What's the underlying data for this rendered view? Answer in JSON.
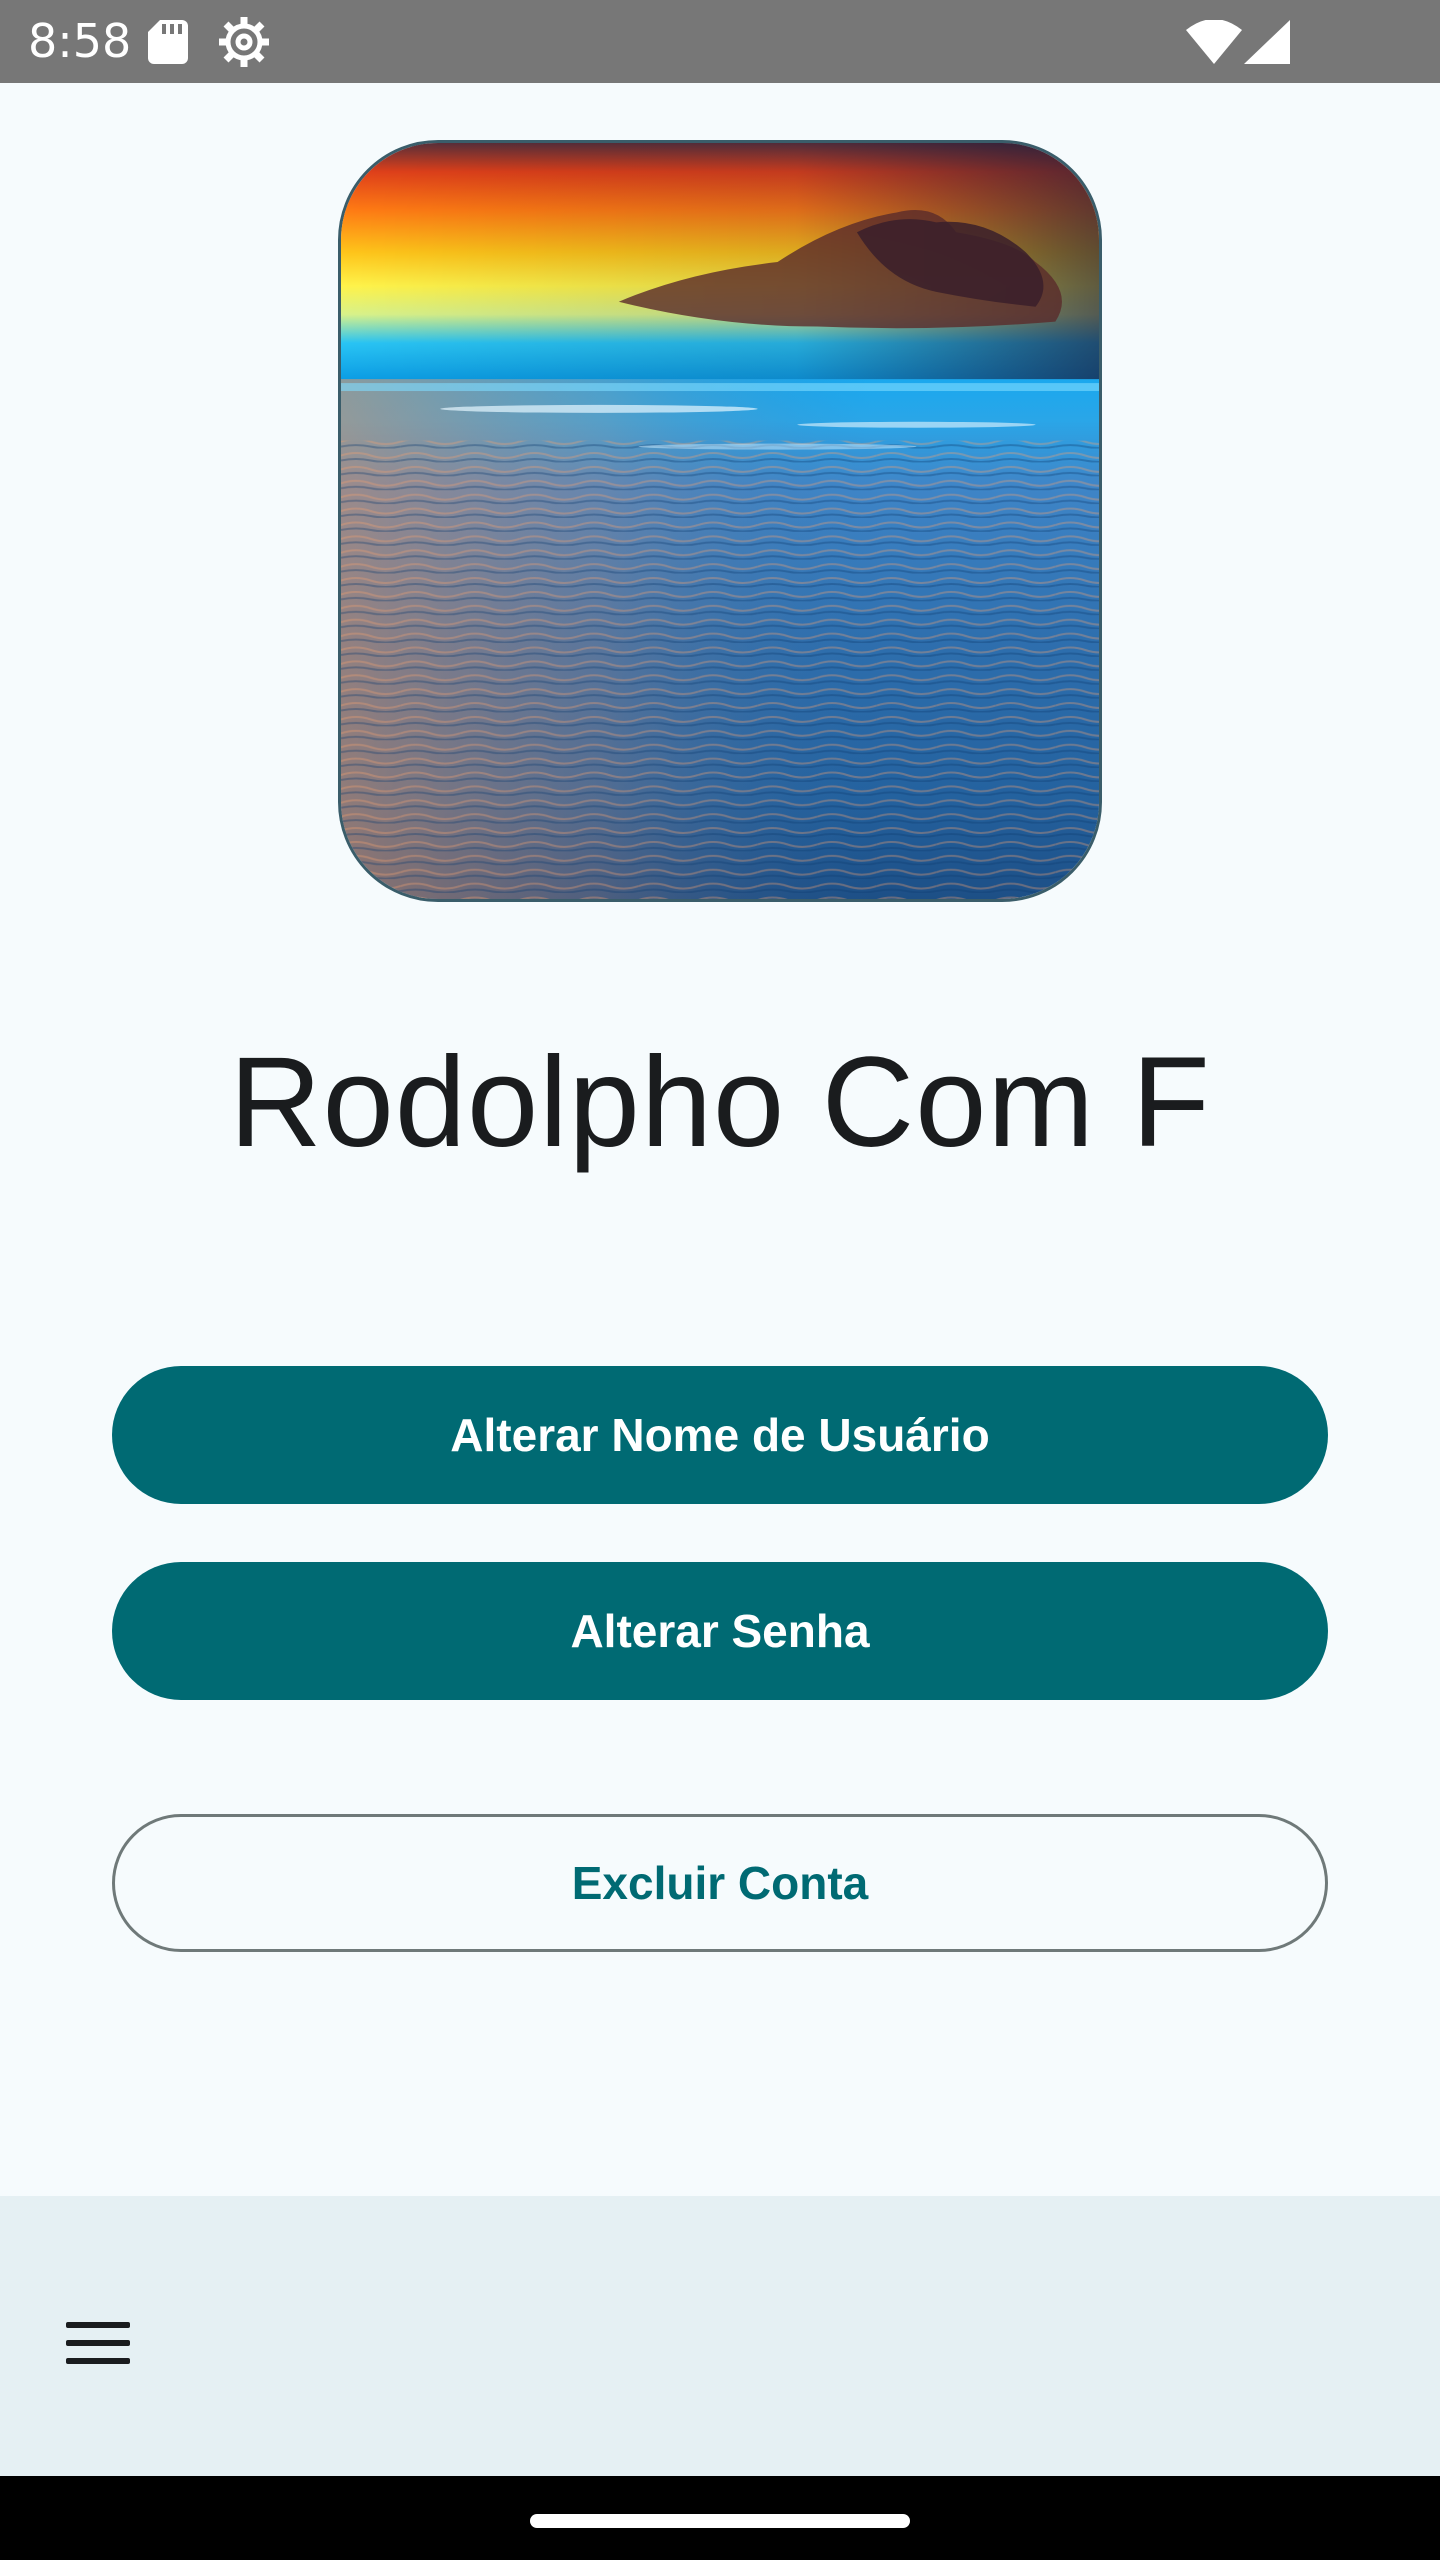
{
  "status_bar": {
    "time": "8:58",
    "icons": [
      "sd-card-icon",
      "settings-icon",
      "wifi-icon",
      "signal-icon"
    ]
  },
  "profile": {
    "avatar_icon": "sunset-ocean-photo",
    "name": "Rodolpho Com F"
  },
  "actions": {
    "change_username_label": "Alterar Nome de Usuário",
    "change_password_label": "Alterar Senha",
    "delete_account_label": "Excluir Conta"
  },
  "bottom_bar": {
    "menu_icon": "hamburger-menu-icon"
  },
  "colors": {
    "primary": "#006a73",
    "background": "#f6fbfd",
    "bottom_bar": "#e5f0f3",
    "status_bar": "#777777",
    "text": "#1a1c1e"
  }
}
